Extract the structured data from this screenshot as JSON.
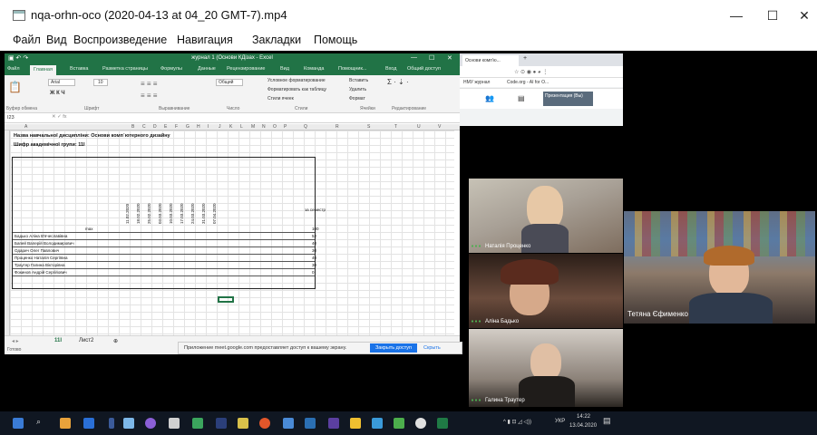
{
  "window": {
    "title": "nqa-orhn-oco (2020-04-13 at 04_20 GMT-7).mp4",
    "minimize": "—",
    "maximize": "☐",
    "close": "✕"
  },
  "menu": [
    "Файл",
    "Вид",
    "Воспроизведение",
    "Навигация",
    "Закладки",
    "Помощь"
  ],
  "excel": {
    "title": "журнал 1 (Основи КДізаx - Excel",
    "tabs": [
      "Файл",
      "Главная",
      "Вставка",
      "Разметка страницы",
      "Формулы",
      "Данные",
      "Рецензирование",
      "Вид",
      "Команда",
      "Помощник...",
      "Вход",
      "Общий доступ"
    ],
    "font": "Arial",
    "font_size": "10",
    "format": "Общий",
    "ribbon_items": [
      "Условное форматирование",
      "Форматировать как таблицу",
      "Стили ячеек",
      "Вставить",
      "Удалить",
      "Формат"
    ],
    "groups": [
      "Буфер обмена",
      "Шрифт",
      "Выравнивание",
      "Число",
      "Стили",
      "Ячейки",
      "Редактирование"
    ],
    "name_box": "I23",
    "heading1": "Назва навчальної дисципліни: Основи комп`ютерного дизайну",
    "heading2": "Шифр академічної групи: 11І",
    "columns": [
      "A",
      "B",
      "C",
      "D",
      "E",
      "F",
      "G",
      "H",
      "I",
      "J",
      "K",
      "L",
      "M",
      "N",
      "O",
      "P",
      "Q",
      "R",
      "S",
      "T",
      "U",
      "V"
    ],
    "dates": [
      "11.02.2020",
      "18.02.2020",
      "25.02.2020",
      "03.03.2020",
      "10.03.2020",
      "17.03.2020",
      "24.03.2020",
      "31.03.2020",
      "07.04.2020"
    ],
    "semester_label": "за семестр",
    "row_label": "max",
    "students": [
      {
        "name": "Бадько Аліна В'ячеславівна",
        "total": "52"
      },
      {
        "name": "Бапей Валерій Володимирович",
        "total": "40"
      },
      {
        "name": "Одарич Олег Павлович",
        "total": "30"
      },
      {
        "name": "Проценко Наталія Сергіївна",
        "total": "40"
      },
      {
        "name": "Траутер Галина Вікторівна",
        "total": "30"
      },
      {
        "name": "Фокинов Андрій Сергійович",
        "total": "0"
      }
    ],
    "max_total": "100",
    "sheet_tabs": [
      "11І",
      "Лист2"
    ],
    "status": "Готово"
  },
  "notification": {
    "text": "Приложение meet.google.com предоставляет доступ к вашему экрану.",
    "share_button": "Закрыть доступ",
    "hide_link": "Скрыть"
  },
  "browser": {
    "tab": "Основи комп'ю...",
    "bookmarks": [
      "НМУ журнал",
      "Code.org - AI for O..."
    ],
    "meet_label": "Презентация (Вы)"
  },
  "participants": [
    {
      "name": "Наталія Проценко"
    },
    {
      "name": "Аліна Бадько"
    },
    {
      "name": "Галина Траутер"
    },
    {
      "name": "Тетяна Єфименко"
    }
  ],
  "taskbar": {
    "lang": "УКР",
    "time": "14:22",
    "date": "13.04.2020"
  }
}
